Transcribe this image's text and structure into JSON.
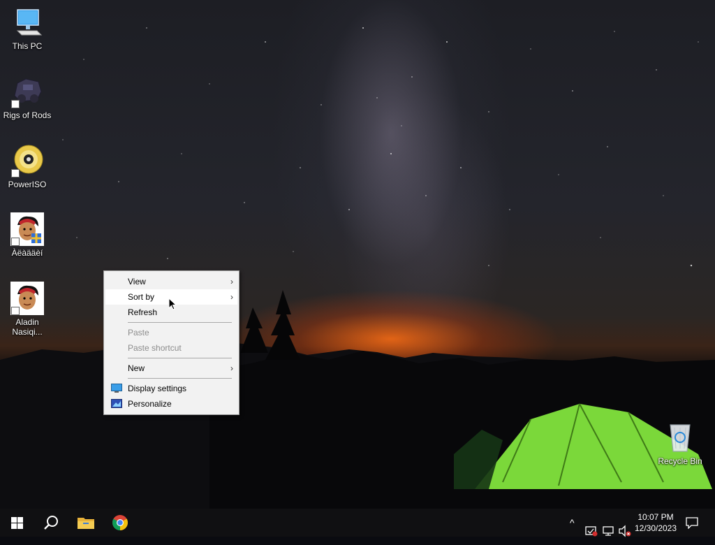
{
  "desktop": {
    "icons": [
      {
        "label": "This PC"
      },
      {
        "label": "Rigs of Rods"
      },
      {
        "label": "PowerISO"
      },
      {
        "label": "Àëàääèí"
      },
      {
        "label": "Aladin Nasiqi..."
      },
      {
        "label": "Recycle Bin"
      }
    ]
  },
  "context_menu": {
    "items": [
      {
        "label": "View",
        "submenu": true
      },
      {
        "label": "Sort by",
        "submenu": true
      },
      {
        "label": "Refresh"
      },
      {
        "label": "Paste",
        "disabled": true
      },
      {
        "label": "Paste shortcut",
        "disabled": true
      },
      {
        "label": "New",
        "submenu": true
      },
      {
        "label": "Display settings",
        "icon": "display-icon"
      },
      {
        "label": "Personalize",
        "icon": "personalize-icon"
      }
    ],
    "arrow_glyph": "›"
  },
  "taskbar": {
    "pinned": [
      "start-icon",
      "search-icon",
      "file-explorer-icon",
      "chrome-icon"
    ],
    "tray": {
      "icons": [
        "chevron-up-icon",
        "security-icon",
        "network-icon",
        "volume-muted-icon"
      ],
      "chevron_glyph": "^",
      "time": "10:07 PM",
      "date": "12/30/2023"
    }
  },
  "colors": {
    "menu_bg": "#f2f2f2",
    "taskbar_bg": "#101012",
    "tent_green": "#7bd83a"
  }
}
